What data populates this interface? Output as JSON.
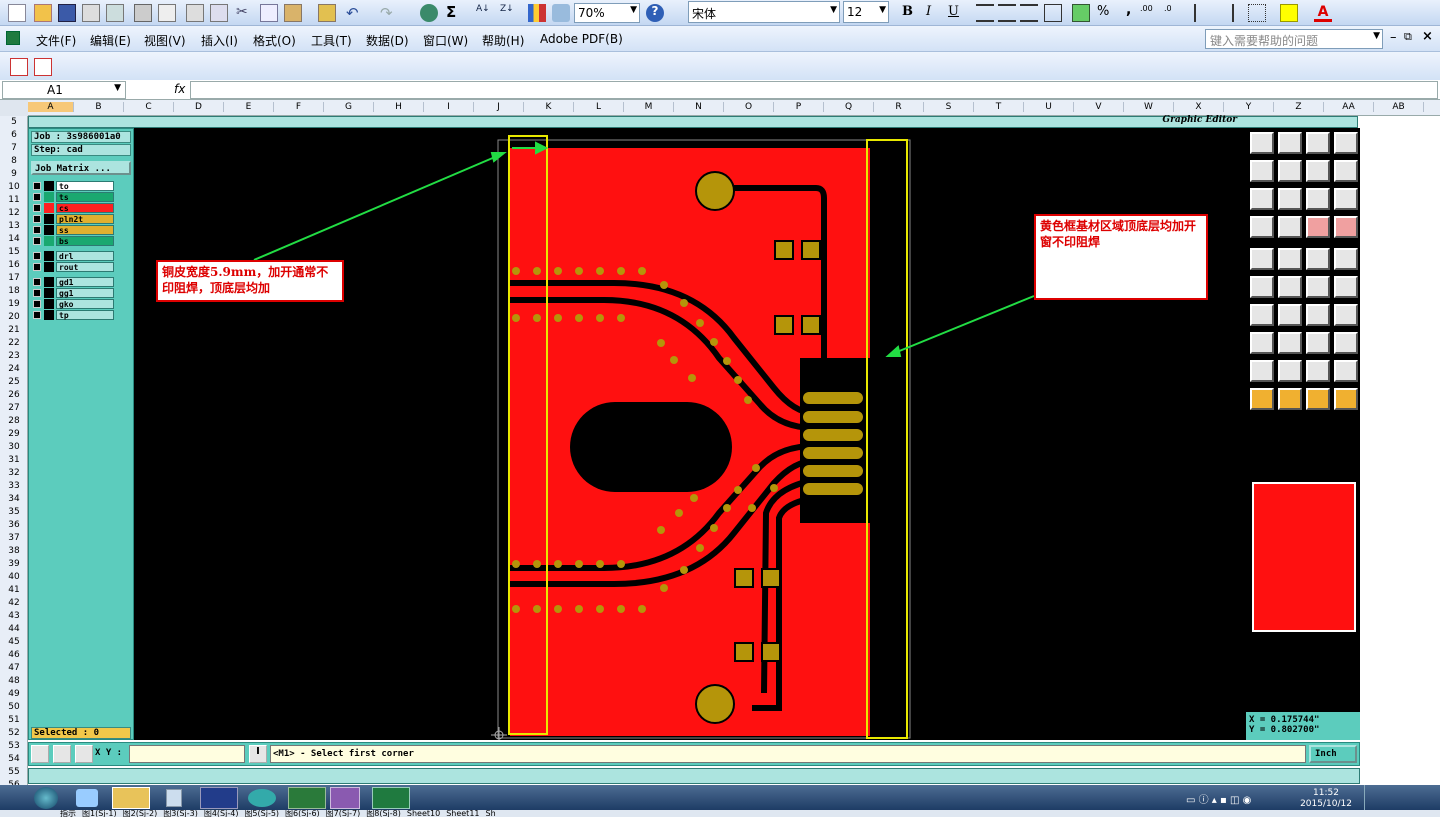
{
  "toolbar": {
    "zoom": "70%",
    "font_name": "宋体",
    "font_size": "12",
    "bold": "B",
    "italic": "I",
    "underline": "U",
    "sum": "Σ",
    "percent": "%",
    "comma": ","
  },
  "menu": {
    "items": [
      "文件(F)",
      "编辑(E)",
      "视图(V)",
      "插入(I)",
      "格式(O)",
      "工具(T)",
      "数据(D)",
      "窗口(W)",
      "帮助(H)",
      "Adobe PDF(B)"
    ],
    "help_placeholder": "键入需要帮助的问题"
  },
  "formula_bar": {
    "name_box": "A1",
    "fx": "fx"
  },
  "columns": [
    "A",
    "B",
    "C",
    "D",
    "E",
    "F",
    "G",
    "H",
    "I",
    "J",
    "K",
    "L",
    "M",
    "N",
    "O",
    "P",
    "Q",
    "R",
    "S",
    "T",
    "U",
    "V",
    "W",
    "X",
    "Y",
    "Z",
    "AA",
    "AB"
  ],
  "rows": [
    "5",
    "6",
    "7",
    "8",
    "9",
    "10",
    "11",
    "12",
    "13",
    "14",
    "15",
    "16",
    "17",
    "18",
    "19",
    "20",
    "21",
    "22",
    "23",
    "24",
    "25",
    "26",
    "27",
    "28",
    "29",
    "30",
    "31",
    "32",
    "33",
    "34",
    "35",
    "36",
    "37",
    "38",
    "39",
    "40",
    "41",
    "42",
    "43",
    "44",
    "45",
    "46",
    "47",
    "48",
    "49",
    "50",
    "51",
    "52",
    "53",
    "54",
    "55",
    "56"
  ],
  "editor": {
    "brand": "Graphic Editor",
    "job": "Job : 3s986001a0",
    "step": "Step: cad",
    "job_matrix": "Job Matrix ...",
    "layers": [
      {
        "name": "to",
        "color": "#ffffff"
      },
      {
        "name": "ts",
        "color": "#1aa870"
      },
      {
        "name": "cs",
        "color": "#ff2020"
      },
      {
        "name": "pln2t",
        "color": "#e0b030"
      },
      {
        "name": "ss",
        "color": "#e0b030"
      },
      {
        "name": "bs",
        "color": "#1aa870"
      },
      {
        "name": "drl",
        "color": "#ace4df"
      },
      {
        "name": "rout",
        "color": "#ace4df"
      },
      {
        "name": "gd1",
        "color": "#ace4df"
      },
      {
        "name": "gg1",
        "color": "#ace4df"
      },
      {
        "name": "gko",
        "color": "#ace4df"
      },
      {
        "name": "tp",
        "color": "#ace4df"
      }
    ],
    "selected": "Selected : 0",
    "xy_label": "X Y :",
    "command": "<M1> - Select first corner",
    "unit": "Inch",
    "coord_x": "X = 0.175744\"",
    "coord_y": "Y = 0.802700\""
  },
  "annotations": {
    "left_note": "铜皮宽度5.9mm，加开通常不印阻焊，顶底层均加",
    "right_note": "黄色框基材区域顶底层均加开窗不印阻焊"
  },
  "taskbar": {
    "time": "11:52",
    "date": "2015/10/12"
  },
  "sheets": [
    "指示",
    "图1(Sj-1)",
    "图2(Sj-2)",
    "图3(Sj-3)",
    "图4(Sj-4)",
    "图5(Sj-5)",
    "图6(Sj-6)",
    "图7(Sj-7)",
    "图8(Sj-8)",
    "Sheet10",
    "Sheet11",
    "Sh"
  ],
  "colors": {
    "board": "#ff1010",
    "pad": "#b5950a",
    "outline": "#e8e800",
    "arrow": "#22dd44",
    "panel": "#5cccbd"
  }
}
